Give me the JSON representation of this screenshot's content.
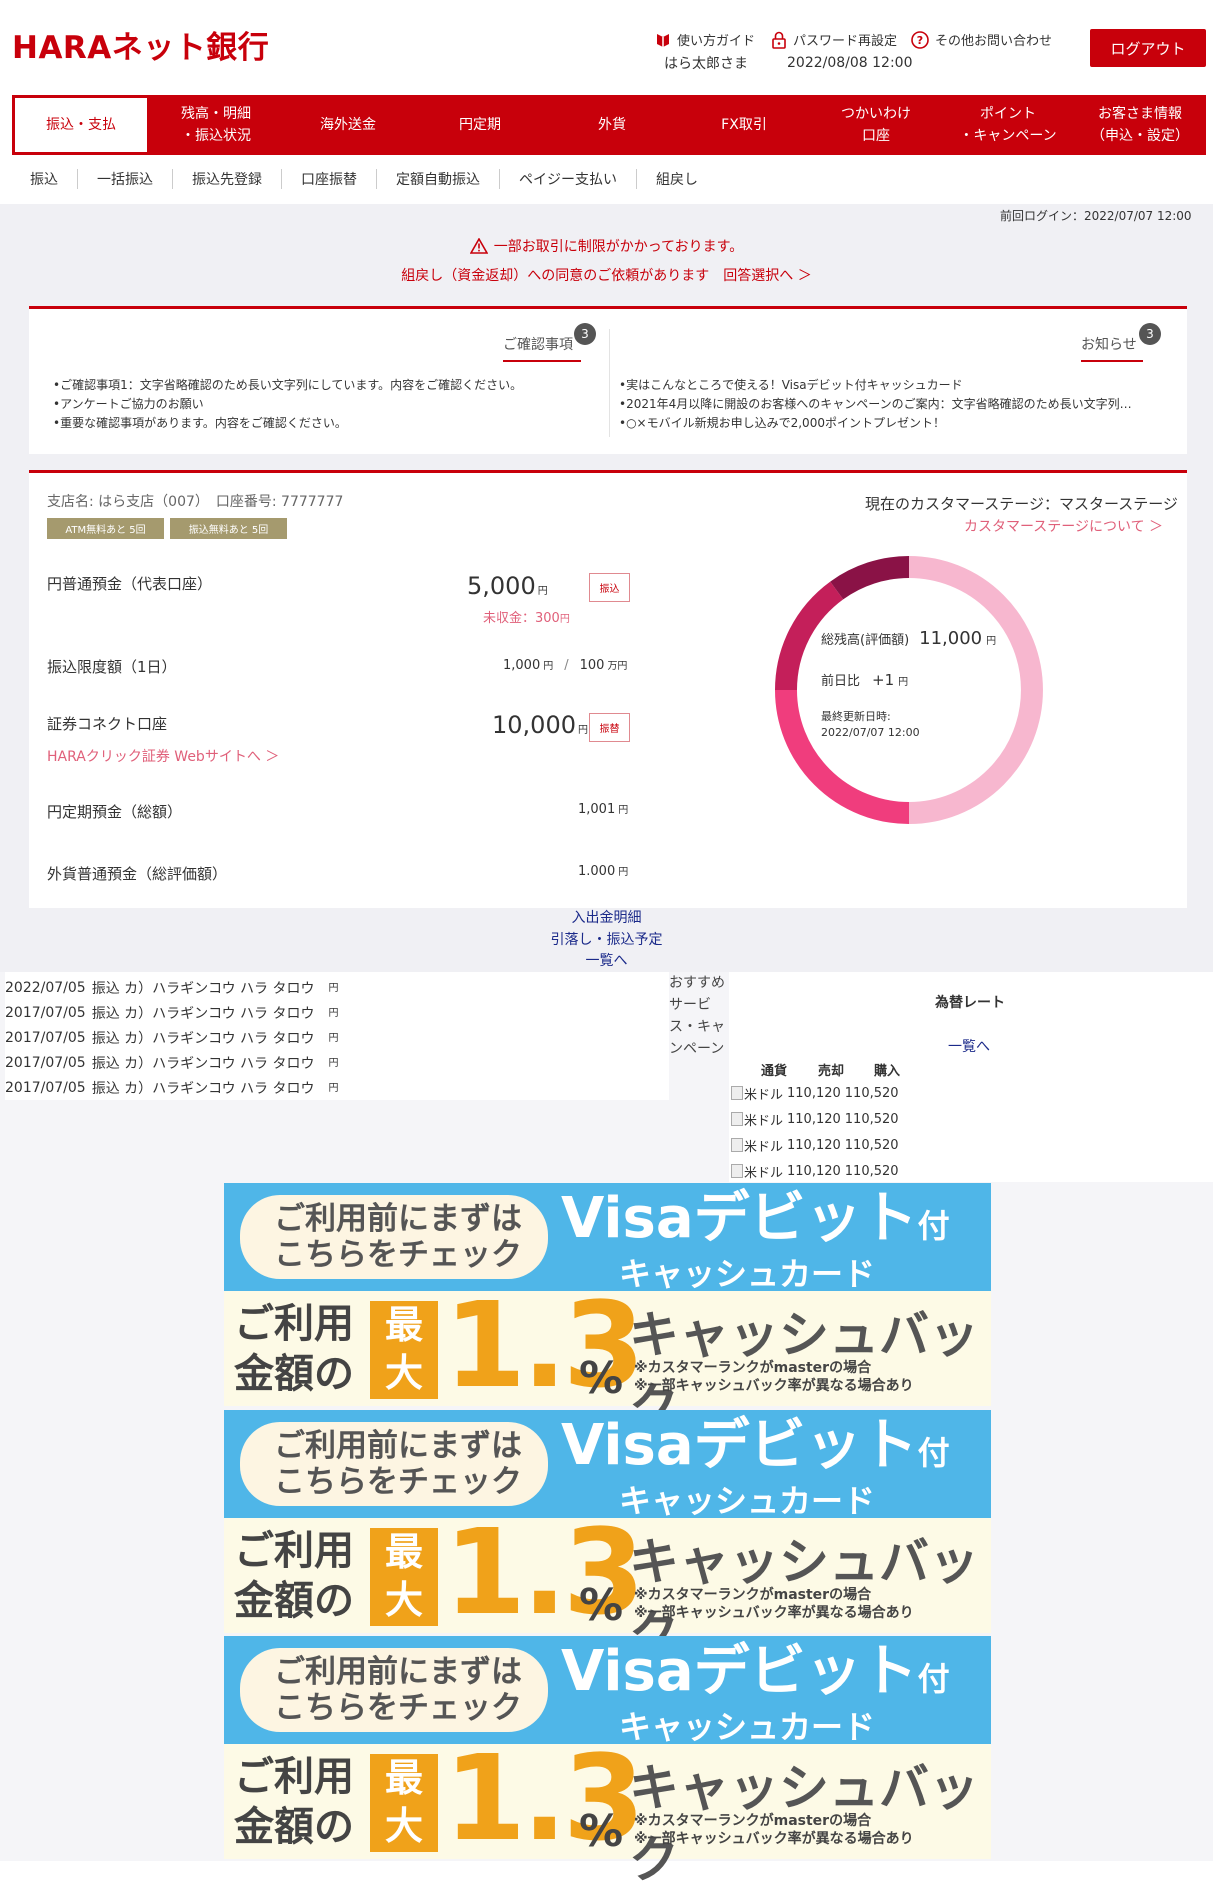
{
  "header": {
    "logo": "HARAネット銀行",
    "guide": "使い方ガイド",
    "password": "パスワード再設定",
    "contact": "その他お問い合わせ",
    "user": "はら太郎さま",
    "datetime": "2022/08/08 12:00",
    "logout": "ログアウト"
  },
  "nav": {
    "tabs": [
      "振込・支払",
      "残高・明細\n・振込状況",
      "海外送金",
      "円定期",
      "外貨",
      "FX取引",
      "つかいわけ\n口座",
      "ポイント\n・キャンペーン",
      "お客さま情報\n（申込・設定）"
    ],
    "sub": [
      "振込",
      "一括振込",
      "振込先登録",
      "口座振替",
      "定額自動振込",
      "ペイジー支払い",
      "組戻し"
    ]
  },
  "last_login": "前回ログイン：2022/07/07 12:00",
  "alert": {
    "line1": "一部お取引に制限がかかっております。",
    "line2": "組戻し（資金返却）への同意のご依頼があります　回答選択へ ＞"
  },
  "notices": {
    "confirm_title": "ご確認事項",
    "confirm_count": "3",
    "confirm_items": [
      "•ご確認事項1：文字省略確認のため長い文字列にしています。内容をご確認ください。",
      "•アンケートご協力のお願い",
      "•重要な確認事項があります。内容をご確認ください。"
    ],
    "news_title": "お知らせ",
    "news_count": "3",
    "news_items": [
      "•実はこんなところで使える！Visaデビット付キャッシュカード",
      "•2021年4月以降に開設のお客様へのキャンペーンのご案内：文字省略確認のため長い文字列…",
      "•○×モバイル新規お申し込みで2,000ポイントプレゼント！"
    ]
  },
  "account": {
    "branch": "支店名: はら支店（007）　口座番号: 7777777",
    "tag1": "ATM無料あと 5回",
    "tag2": "振込無料あと 5回",
    "stage": "現在のカスタマーステージ：マスターステージ",
    "stage_link": "カスタマーステージについて ＞",
    "yen_deposit_label": "円普通預金（代表口座）",
    "yen_deposit_amount": "5,000",
    "yen_unit": "円",
    "furikomi_btn": "振込",
    "uncollected": "未収金：300",
    "limit_label": "振込限度額（1日）",
    "limit_a": "1,000",
    "limit_sep": "/",
    "limit_b": "100",
    "man_yen": "万円",
    "sec_label": "証券コネクト口座",
    "sec_amount": "10,000",
    "sec_btn": "振替",
    "sec_link": "HARAクリック証券 Webサイトへ ＞",
    "time_deposit_label": "円定期預金（総額）",
    "time_deposit_amount": "1,001",
    "fx_deposit_label": "外貨普通預金（総評価額）",
    "fx_deposit_amount": "1.000",
    "donut_total_label": "総残高(評価額)",
    "donut_total": "11,000",
    "donut_diff_label": "前日比",
    "donut_diff": "+1",
    "donut_updated_label": "最終更新日時:",
    "donut_updated": "2022/07/07 12:00"
  },
  "donut": {
    "colors": [
      "#f7b7cf",
      "#f03d7d",
      "#c41f5a",
      "#8a1246"
    ],
    "values": [
      50,
      25,
      15,
      10
    ]
  },
  "links": {
    "statement": "入出金明細",
    "schedule": "引落し・振込予定",
    "list": "一覧へ"
  },
  "transactions": [
    {
      "date": "2022/07/05",
      "text": "振込 カ）ハラギンコウ ハラ タロウ",
      "unit": "円"
    },
    {
      "date": "2017/07/05",
      "text": "振込 カ）ハラギンコウ ハラ タロウ",
      "unit": "円"
    },
    {
      "date": "2017/07/05",
      "text": "振込 カ）ハラギンコウ ハラ タロウ",
      "unit": "円"
    },
    {
      "date": "2017/07/05",
      "text": "振込 カ）ハラギンコウ ハラ タロウ",
      "unit": "円"
    },
    {
      "date": "2017/07/05",
      "text": "振込 カ）ハラギンコウ ハラ タロウ",
      "unit": "円"
    }
  ],
  "recommend": "おすすめサービス・キャンペーン",
  "fx": {
    "title": "為替レート",
    "list_link": "一覧へ",
    "col_currency": "通貨",
    "col_sell": "売却",
    "col_buy": "購入",
    "rows": [
      {
        "currency": "米ドル",
        "sell": "110,120",
        "buy": "110,520"
      },
      {
        "currency": "米ドル",
        "sell": "110,120",
        "buy": "110,520"
      },
      {
        "currency": "米ドル",
        "sell": "110,120",
        "buy": "110,520"
      },
      {
        "currency": "米ドル",
        "sell": "110,120",
        "buy": "110,520"
      }
    ]
  },
  "banner": {
    "pill": "ご利用前にまずは\nこちらをチェック",
    "visa": "Visaデビット",
    "visa_suffix": "付",
    "cash_card": "キャッシュカード",
    "usage": "ご利用\n金額の",
    "max": "最\n大",
    "rate": "1.3",
    "pct": "%",
    "cashback": "キャッシュバック",
    "note1": "※カスタマーランクがmasterの場合",
    "note2": "※一部キャッシュバック率が異なる場合あり"
  }
}
